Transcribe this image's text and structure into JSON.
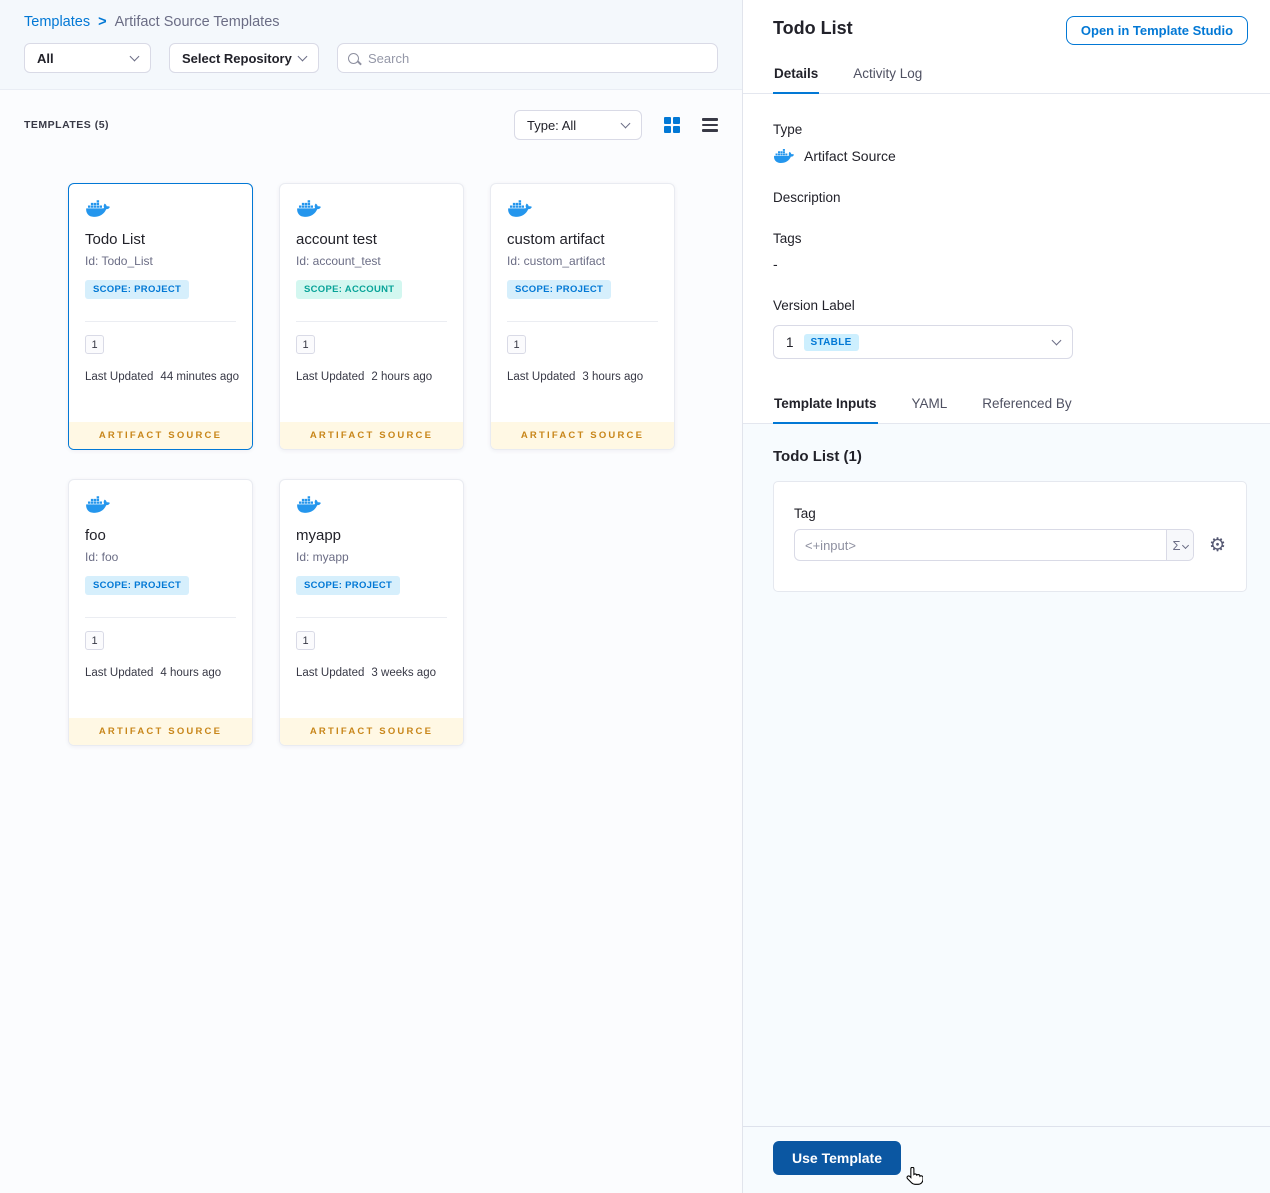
{
  "breadcrumb": {
    "root": "Templates",
    "separator": ">",
    "current": "Artifact Source Templates"
  },
  "filters": {
    "scope": "All",
    "repository": "Select Repository",
    "search_placeholder": "Search"
  },
  "list": {
    "count_label": "TEMPLATES (5)",
    "type_filter": "Type: All"
  },
  "cards": [
    {
      "name": "Todo List",
      "id": "Id: Todo_List",
      "scope": "SCOPE: PROJECT",
      "version": "1",
      "updated_label": "Last Updated",
      "updated": "44 minutes ago",
      "footer": "ARTIFACT SOURCE"
    },
    {
      "name": "account test",
      "id": "Id: account_test",
      "scope": "SCOPE: ACCOUNT",
      "version": "1",
      "updated_label": "Last Updated",
      "updated": "2 hours ago",
      "footer": "ARTIFACT SOURCE"
    },
    {
      "name": "custom artifact",
      "id": "Id: custom_artifact",
      "scope": "SCOPE: PROJECT",
      "version": "1",
      "updated_label": "Last Updated",
      "updated": "3 hours ago",
      "footer": "ARTIFACT SOURCE"
    },
    {
      "name": "foo",
      "id": "Id: foo",
      "scope": "SCOPE: PROJECT",
      "version": "1",
      "updated_label": "Last Updated",
      "updated": "4 hours ago",
      "footer": "ARTIFACT SOURCE"
    },
    {
      "name": "myapp",
      "id": "Id: myapp",
      "scope": "SCOPE: PROJECT",
      "version": "1",
      "updated_label": "Last Updated",
      "updated": "3 weeks ago",
      "footer": "ARTIFACT SOURCE"
    }
  ],
  "panel": {
    "title": "Todo List",
    "open_button": "Open in Template Studio",
    "tabs": [
      "Details",
      "Activity Log"
    ],
    "details": {
      "type_label": "Type",
      "type_value": "Artifact Source",
      "description_label": "Description",
      "tags_label": "Tags",
      "tags_value": "-",
      "version_label": "Version Label",
      "version_value": "1",
      "version_badge": "STABLE"
    },
    "inner_tabs": [
      "Template Inputs",
      "YAML",
      "Referenced By"
    ],
    "inputs": {
      "heading": "Todo List (1)",
      "tag_label": "Tag",
      "tag_value": "<+input>",
      "sigma_symbol": "Σ"
    },
    "use_button": "Use Template"
  },
  "colors": {
    "primary": "#0278d5",
    "docker_blue": "#2496ed",
    "artifact_source_text": "#c8861a",
    "stable_badge_text": "#0278d5"
  }
}
